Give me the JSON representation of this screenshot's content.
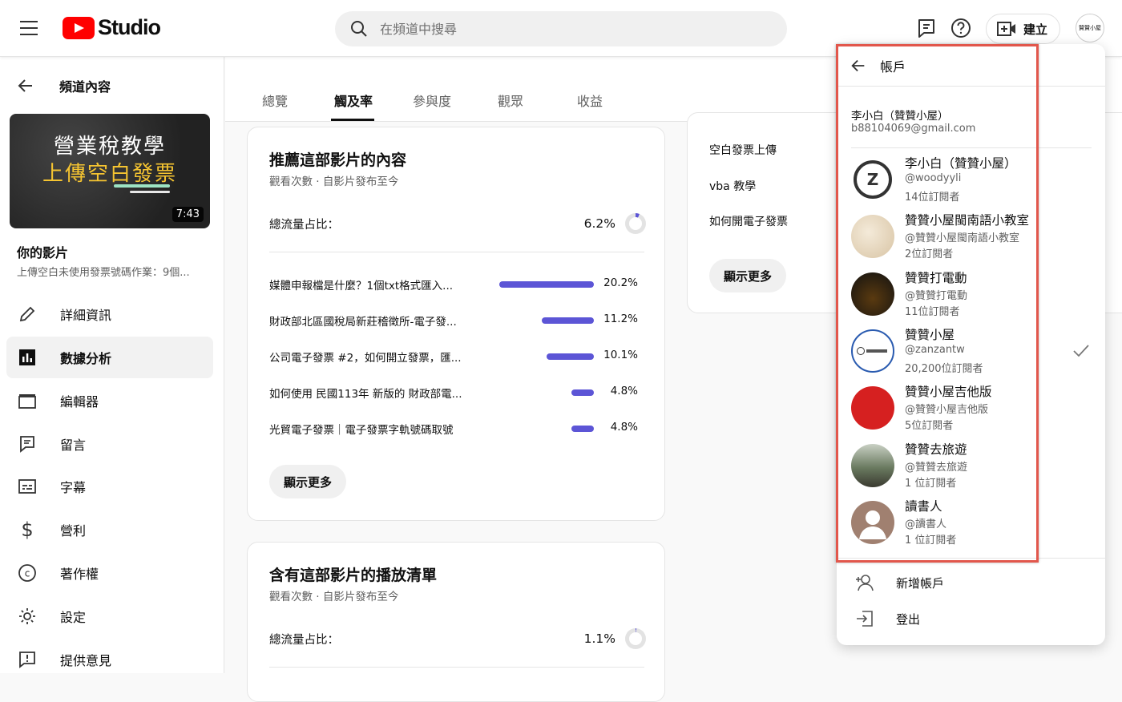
{
  "header": {
    "logo_text": "Studio",
    "search_placeholder": "在頻道中搜尋",
    "create_label": "建立",
    "avatar_text": "贊贊小屋"
  },
  "sidebar": {
    "back_label": "頻道內容",
    "thumb": {
      "line1": "營業稅教學",
      "line2": "上傳空白發票",
      "duration": "7:43"
    },
    "your_video": "你的影片",
    "video_title": "上傳空白未使用發票號碼作業：9個...",
    "items": [
      {
        "label": "詳細資訊",
        "icon": "pencil-icon"
      },
      {
        "label": "數據分析",
        "icon": "analytics-icon",
        "active": true
      },
      {
        "label": "編輯器",
        "icon": "clapperboard-icon"
      },
      {
        "label": "留言",
        "icon": "comment-icon"
      },
      {
        "label": "字幕",
        "icon": "subtitles-icon"
      },
      {
        "label": "營利",
        "icon": "dollar-icon"
      },
      {
        "label": "著作權",
        "icon": "copyright-icon"
      },
      {
        "label": "設定",
        "icon": "gear-icon"
      },
      {
        "label": "提供意見",
        "icon": "feedback-icon"
      }
    ]
  },
  "tabs": [
    {
      "label": "總覽"
    },
    {
      "label": "觸及率",
      "active": true
    },
    {
      "label": "參與度"
    },
    {
      "label": "觀眾"
    },
    {
      "label": "收益"
    }
  ],
  "card_suggested": {
    "title": "推薦這部影片的內容",
    "subtitle": "觀看次數 · 自影片發布至今",
    "share_label": "總流量占比：",
    "share_value": "6.2%",
    "share_fraction": 0.062,
    "rows": [
      {
        "title": "媒體申報檔是什麼？1個txt格式匯入...",
        "pct": "20.2%",
        "value": 20.2
      },
      {
        "title": "財政部北區國稅局新莊稽徵所-電子發...",
        "pct": "11.2%",
        "value": 11.2
      },
      {
        "title": "公司電子發票 #2，如何開立發票，匯...",
        "pct": "10.1%",
        "value": 10.1
      },
      {
        "title": "如何使用 民國113年 新版的 財政部電...",
        "pct": "4.8%",
        "value": 4.8
      },
      {
        "title": "光貿電子發票｜電子發票字軌號碼取號",
        "pct": "4.8%",
        "value": 4.8
      }
    ],
    "more_label": "顯示更多"
  },
  "card_playlist": {
    "title": "含有這部影片的播放清單",
    "subtitle": "觀看次數 · 自影片發布至今",
    "share_label": "總流量占比：",
    "share_value": "1.1%",
    "share_fraction": 0.011
  },
  "card_search": {
    "terms": [
      "空白發票上傳",
      "vba 教學",
      "如何開電子發票"
    ],
    "more_label": "顯示更多"
  },
  "account_menu": {
    "title": "帳戶",
    "current_name": "李小白（贊贊小屋）",
    "current_email": "b88104069@gmail.com",
    "accounts": [
      {
        "name": "李小白（贊贊小屋）",
        "handle": "@woodyyli",
        "subs": "14位訂閱者",
        "avatar_color": "#ffffff"
      },
      {
        "name": "贊贊小屋閩南語小教室",
        "handle": "@贊贊小屋閩南語小教室",
        "subs": "2位訂閱者",
        "avatar_color": "#e9dcc6"
      },
      {
        "name": "贊贊打電動",
        "handle": "@贊贊打電動",
        "subs": "11位訂閱者",
        "avatar_color": "#1a1a1a"
      },
      {
        "name": "贊贊小屋",
        "handle": "@zanzantw",
        "subs": "20,200位訂閱者",
        "avatar_color": "#ffffff",
        "selected": true
      },
      {
        "name": "贊贊小屋吉他版",
        "handle": "@贊贊小屋吉他版",
        "subs": "5位訂閱者",
        "avatar_color": "#d62020"
      },
      {
        "name": "贊贊去旅遊",
        "handle": "@贊贊去旅遊",
        "subs": "1 位訂閱者",
        "avatar_color": "#5a6658"
      },
      {
        "name": "讀書人",
        "handle": "@讀書人",
        "subs": "1 位訂閱者",
        "avatar_color": "#a08070"
      }
    ],
    "add_account": "新增帳戶",
    "sign_out": "登出"
  }
}
